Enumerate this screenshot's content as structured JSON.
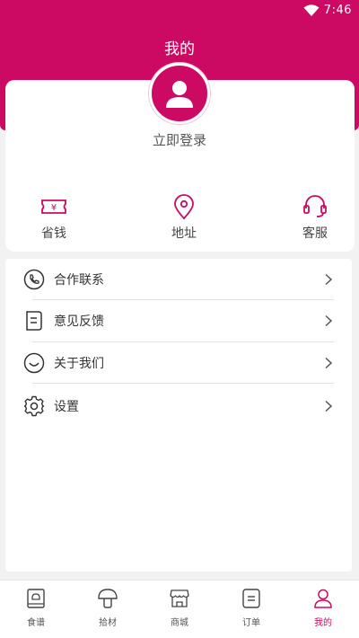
{
  "status_bar": {
    "time": "7:46"
  },
  "header": {
    "title": "我的"
  },
  "profile": {
    "login_label": "立即登录"
  },
  "quick_actions": [
    {
      "label": "省钱",
      "icon": "coupon-icon"
    },
    {
      "label": "地址",
      "icon": "location-pin-icon"
    },
    {
      "label": "客服",
      "icon": "headset-icon"
    }
  ],
  "menu": [
    {
      "label": "合作联系",
      "icon": "phone-icon"
    },
    {
      "label": "意见反馈",
      "icon": "feedback-icon"
    },
    {
      "label": "关于我们",
      "icon": "smile-icon"
    },
    {
      "label": "设置",
      "icon": "gear-icon"
    }
  ],
  "tabbar": [
    {
      "label": "食谱",
      "icon": "recipe-book-icon",
      "active": false
    },
    {
      "label": "拾材",
      "icon": "mushroom-icon",
      "active": false
    },
    {
      "label": "商城",
      "icon": "store-icon",
      "active": false
    },
    {
      "label": "订单",
      "icon": "order-icon",
      "active": false
    },
    {
      "label": "我的",
      "icon": "user-icon",
      "active": true
    }
  ],
  "colors": {
    "accent": "#cc0a63",
    "background": "#f2f2f2"
  }
}
